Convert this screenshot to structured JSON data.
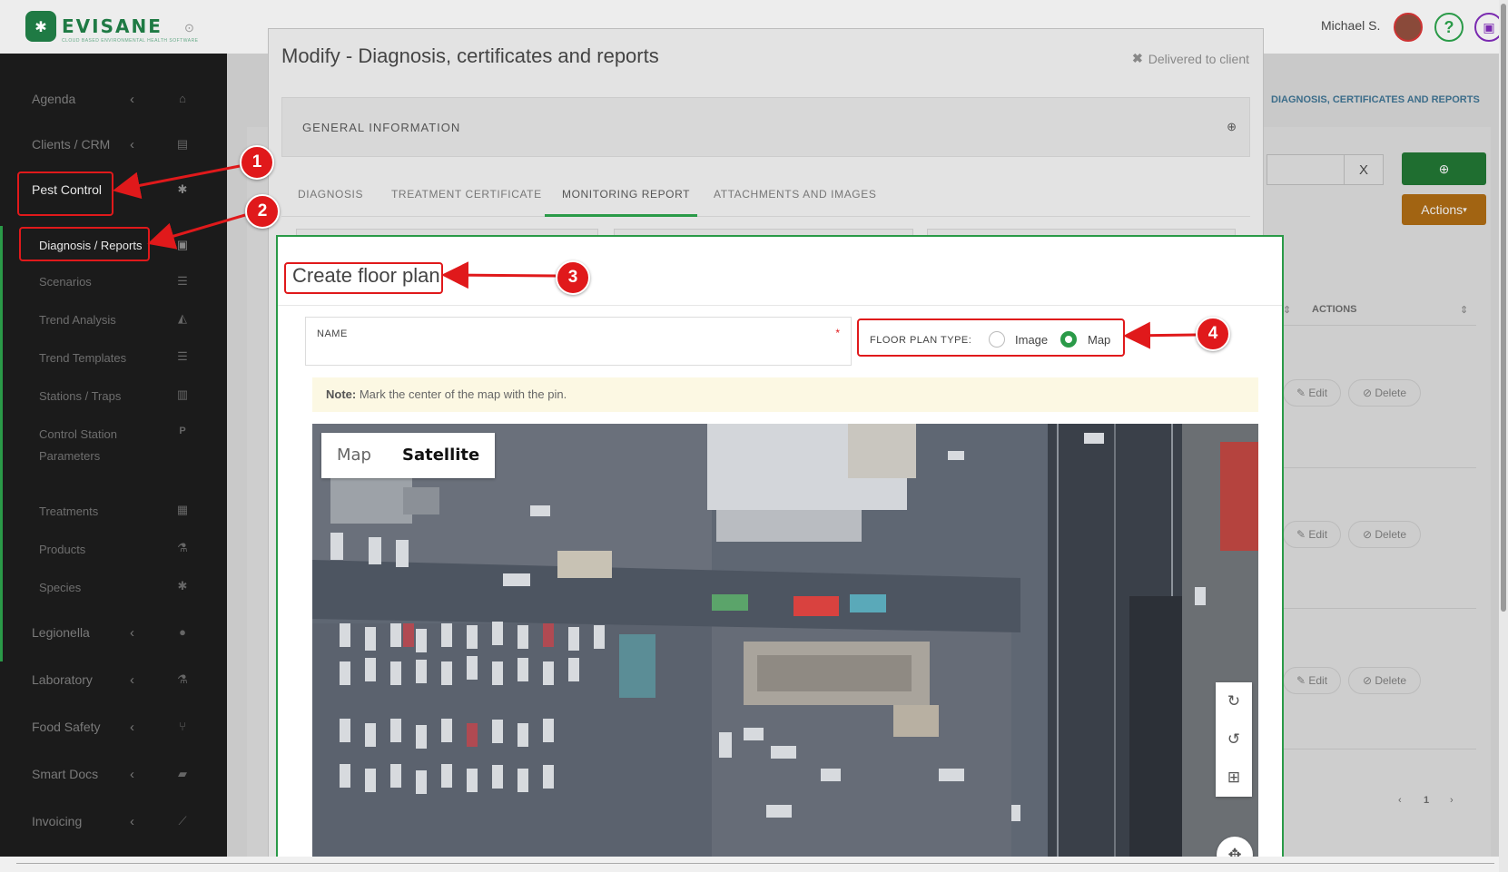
{
  "brand": {
    "name": "EVISANE",
    "tagline": "CLOUD BASED ENVIRONMENTAL HEALTH SOFTWARE"
  },
  "header": {
    "user_name": "Michael S.",
    "help_glyph": "?"
  },
  "sidebar": {
    "items": [
      {
        "label": "Agenda",
        "icon": "home-icon"
      },
      {
        "label": "Clients / CRM",
        "icon": "id-card-icon"
      },
      {
        "label": "Pest Control",
        "icon": "bug-icon"
      },
      {
        "label": "Legionella",
        "icon": "drop-icon"
      },
      {
        "label": "Laboratory",
        "icon": "flask-icon"
      },
      {
        "label": "Food Safety",
        "icon": "cutlery-icon"
      },
      {
        "label": "Smart Docs",
        "icon": "folder-icon"
      },
      {
        "label": "Invoicing",
        "icon": "chart-icon"
      }
    ],
    "pest_sub": [
      {
        "label": "Diagnosis / Reports"
      },
      {
        "label": "Scenarios"
      },
      {
        "label": "Trend Analysis"
      },
      {
        "label": "Trend Templates"
      },
      {
        "label": "Stations / Traps"
      },
      {
        "label": "Control Station Parameters"
      },
      {
        "label": "Treatments"
      },
      {
        "label": "Products"
      },
      {
        "label": "Species"
      }
    ]
  },
  "background": {
    "breadcrumb": "DIAGNOSIS, CERTIFICATES AND REPORTS",
    "clear_label": "X",
    "actions_label": "Actions",
    "column_actions": "ACTIONS",
    "edit_label": "Edit",
    "delete_label": "Delete",
    "page_number": "1"
  },
  "modal": {
    "title": "Modify - Diagnosis, certificates and reports",
    "status": "Delivered to client",
    "general_info": "GENERAL INFORMATION",
    "tabs": [
      {
        "label": "DIAGNOSIS"
      },
      {
        "label": "TREATMENT CERTIFICATE"
      },
      {
        "label": "MONITORING REPORT",
        "active": true
      },
      {
        "label": "ATTACHMENTS AND IMAGES"
      }
    ]
  },
  "floor_plan": {
    "title": "Create floor plan",
    "name_label": "NAME",
    "required_mark": "*",
    "type_label": "FLOOR PLAN TYPE:",
    "options": [
      {
        "label": "Image",
        "selected": false
      },
      {
        "label": "Map",
        "selected": true
      }
    ],
    "note_label": "Note:",
    "note_text": "Mark the center of the map with the pin.",
    "map_types": [
      {
        "label": "Map",
        "active": false
      },
      {
        "label": "Satellite",
        "active": true
      }
    ]
  },
  "callouts": [
    "1",
    "2",
    "3",
    "4"
  ],
  "colors": {
    "accent": "#2a9a48",
    "annotation": "#e0191b",
    "note_bg": "#fcf8e3"
  }
}
